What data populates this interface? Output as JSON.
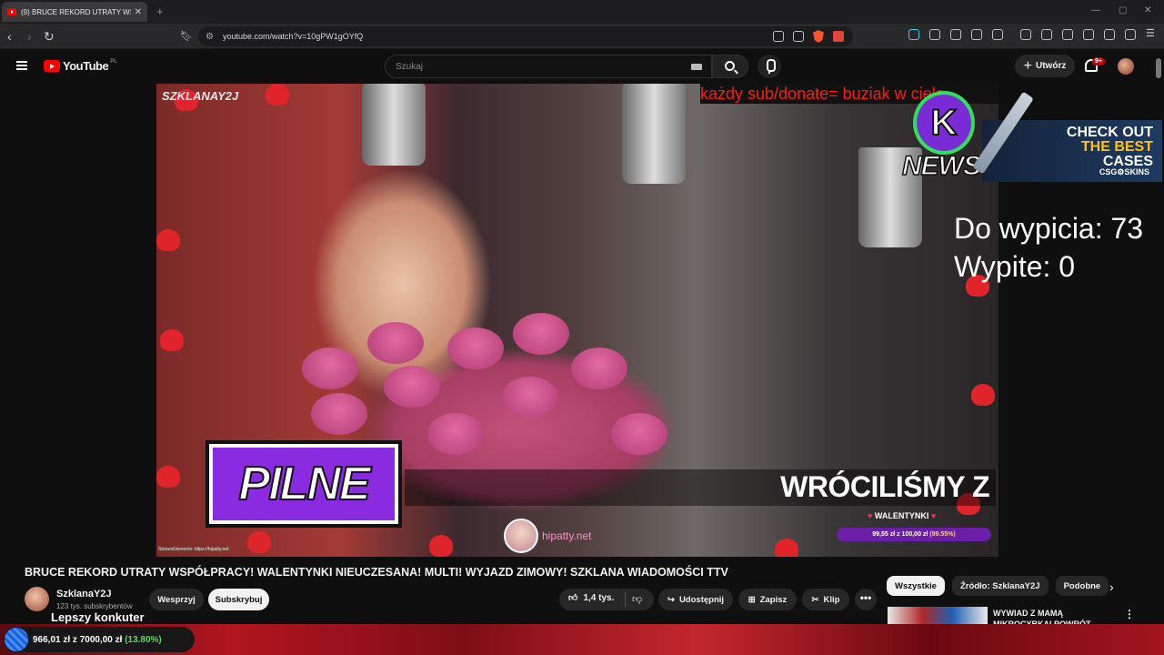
{
  "browser": {
    "tab_title": "(9) BRUCE REKORD UTRATY WSP",
    "new_tab": "+",
    "url": "youtube.com/watch?v=10gPW1gOYfQ"
  },
  "youtube": {
    "logo_text": "YouTube",
    "region": "PL",
    "search_placeholder": "Szukaj",
    "create_label": "Utwórz",
    "notifications_count": "9+"
  },
  "video_overlay": {
    "channel_tag": "SZKLANAY2J",
    "ticker": "każdy sub/donate= buziak w ciele",
    "pilne": "PILNE",
    "banner_text": "WRÓCILIŚMY Z",
    "walentynki_label": "WALENTYNKI",
    "goal_text": "99,55 zł z 100,00 zł",
    "goal_percent": "(99.55%)",
    "hipatty": "hipatty.net",
    "streamelements": "StreamElements: https://hipatty.net",
    "knews_k": "K",
    "knews": "NEWS",
    "cases_line1": "CHECK OUT",
    "cases_line2": "THE BEST",
    "cases_line3": "CASES",
    "cases_brand": "CSG⚙SKINS",
    "do_wypicia": "Do wypicia: 73",
    "wypite": "Wypite: 0"
  },
  "video": {
    "title": "BRUCE REKORD UTRATY WSPÓŁPRACY! WALENTYNKI NIEUCZESANA! MULTI! WYJAZD ZIMOWY! SZKLANA WIADOMOŚCI TTV",
    "channel_name": "SzklanaY2J",
    "subscribers": "123 tys. subskrybentów",
    "support_label": "Wesprzyj",
    "subscribe_label": "Subskrybuj",
    "likes": "1,4 tys.",
    "share_label": "Udostępnij",
    "save_label": "Zapisz",
    "clip_label": "Klip",
    "more": "•••"
  },
  "sidebar": {
    "chips": [
      "Wszystkie",
      "Źródło: SzklanaY2J",
      "Podobne"
    ],
    "rec_title_line1": "WYWIAD Z MAMĄ",
    "rec_title_line2": "MIKROCYBKAI POWRÓT"
  },
  "bottom_overlay": {
    "goal_amount": "966,01 zł z 7000,00 zł",
    "goal_percent": "(13.80%)",
    "caption": "Lepszy konkuter"
  }
}
